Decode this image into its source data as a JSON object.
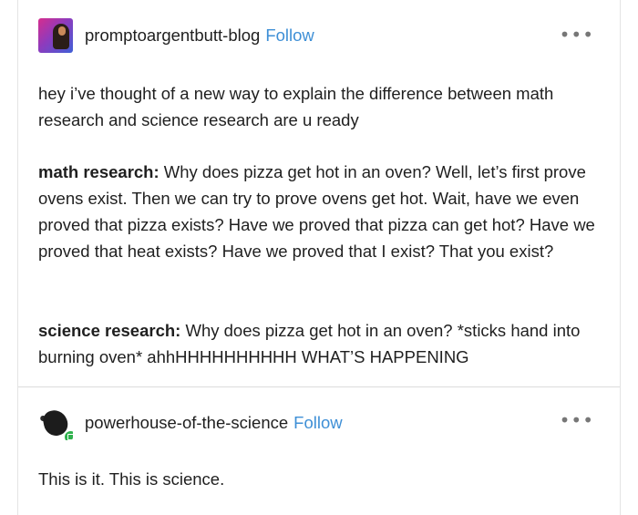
{
  "posts": [
    {
      "blog_name": "promptoargentbutt-blog",
      "follow_label": "Follow",
      "more_label": "•••",
      "paragraphs": {
        "intro": "hey i’ve thought of a new way to explain the difference between math research and science research are u ready",
        "math_label": "math research:",
        "math_text": " Why does pizza get hot in an oven? Well, let’s first prove ovens exist. Then we can try to prove ovens get hot.  Wait, have we even proved that pizza exists? Have we proved that pizza can get hot? Have we proved that heat exists? Have we proved that I exist? That you exist?",
        "science_label": "science research:",
        "science_text": " Why does pizza get hot in an oven? *sticks hand into burning oven* ahhHHHHHHHHHH WHAT’S HAPPENING"
      }
    },
    {
      "blog_name": "powerhouse-of-the-science",
      "follow_label": "Follow",
      "more_label": "•••",
      "paragraphs": {
        "reply": "This is it. This is science."
      }
    }
  ],
  "icons": {
    "more": "more-options-icon",
    "badge": "reblog-badge-icon"
  },
  "colors": {
    "follow": "#3e8fd6",
    "text": "#1f1f1f",
    "badge": "#2fb14d"
  }
}
